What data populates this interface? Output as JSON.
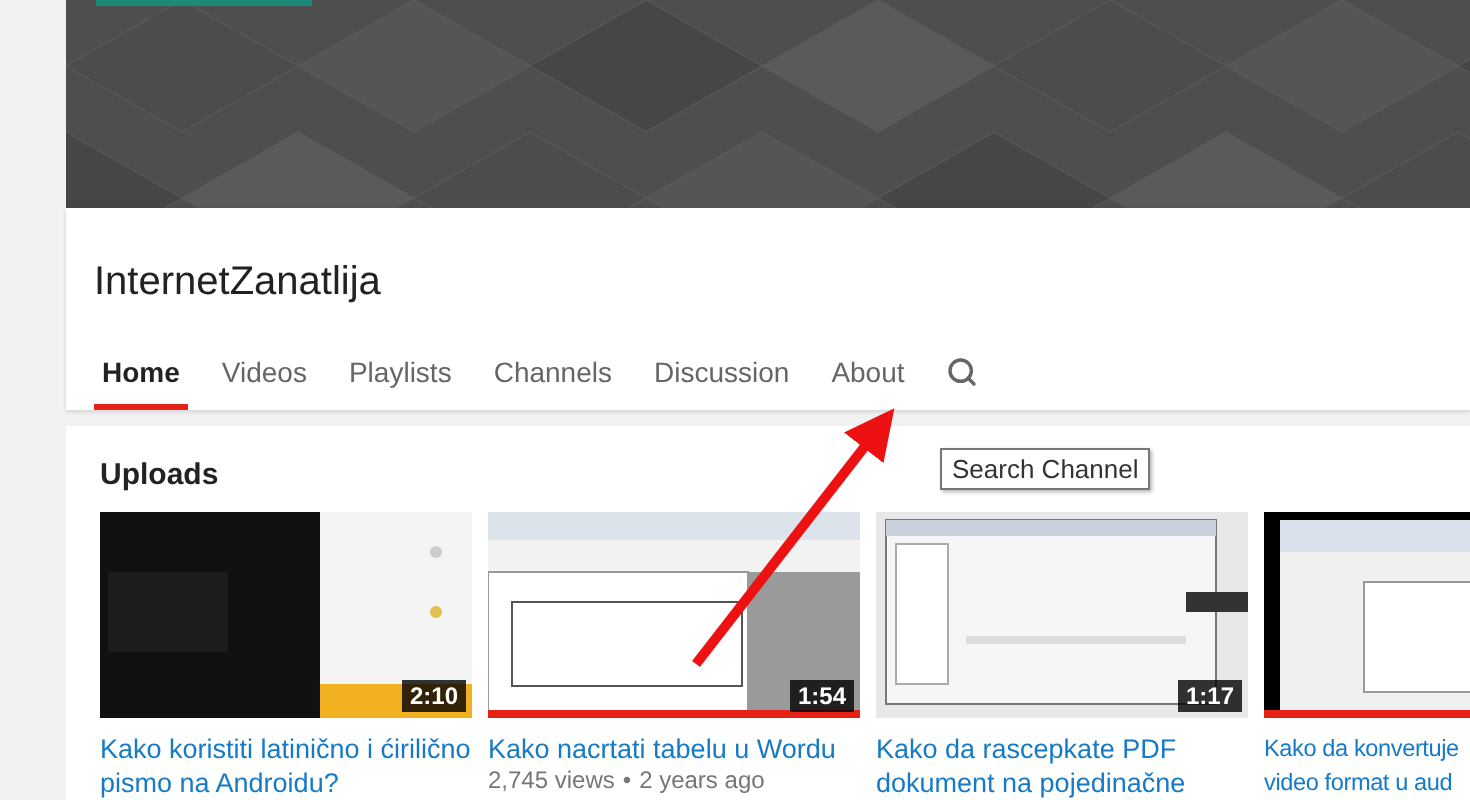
{
  "channel": {
    "name": "InternetZanatlija"
  },
  "tabs": [
    {
      "label": "Home",
      "selected": true
    },
    {
      "label": "Videos",
      "selected": false
    },
    {
      "label": "Playlists",
      "selected": false
    },
    {
      "label": "Channels",
      "selected": false
    },
    {
      "label": "Discussion",
      "selected": false
    },
    {
      "label": "About",
      "selected": false
    }
  ],
  "search_tooltip": "Search Channel",
  "section_title": "Uploads",
  "videos": [
    {
      "title": "Kako koristiti latinično i ćirilično\npismo na Androidu?",
      "duration": "2:10"
    },
    {
      "title": "Kako nacrtati tabelu u Wordu",
      "duration": "1:54",
      "level": 1,
      "views": "2,745 views",
      "separator": "•",
      "age": "2 years ago"
    },
    {
      "title": "Kako da rascepkate PDF\ndokument na pojedinačne",
      "duration": "1:17"
    },
    {
      "title": "Kako da konvertuje\nvideo format u aud",
      "level": 1
    }
  ]
}
